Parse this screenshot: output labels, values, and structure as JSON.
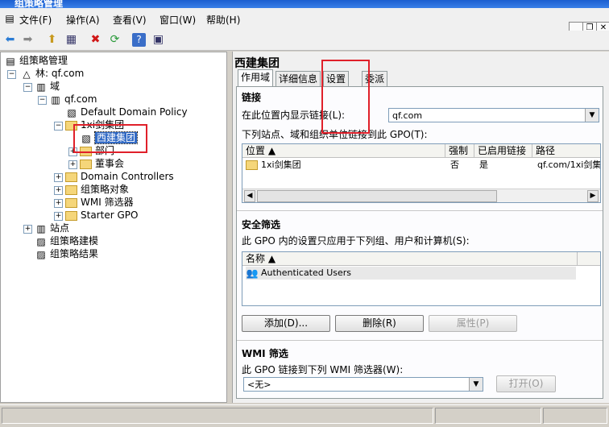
{
  "window": {
    "title": "组策略管理"
  },
  "menu": [
    "文件(F)",
    "操作(A)",
    "查看(V)",
    "窗口(W)",
    "帮助(H)"
  ],
  "tree": {
    "root": "组策略管理",
    "forest": "林: qf.com",
    "domains": "域",
    "domain": "qf.com",
    "default_policy": "Default Domain Policy",
    "ou": "1xi剑集团",
    "ou_gpo": "西建集团",
    "ou_child1": "部门",
    "ou_child2": "董事会",
    "dc": "Domain Controllers",
    "gpo_objects": "组策略对象",
    "wmi": "WMI 筛选器",
    "starter": "Starter GPO",
    "sites": "站点",
    "modeling": "组策略建模",
    "results": "组策略结果"
  },
  "detail": {
    "title": "西建集团",
    "tabs": [
      "作用域",
      "详细信息",
      "设置",
      "委派"
    ],
    "links_section": "链接",
    "links_label": "在此位置内显示链接(L):",
    "links_value": "qf.com",
    "links_desc": "下列站点、域和组织单位链接到此 GPO(T):",
    "links_columns": [
      "位置",
      "强制",
      "已启用链接",
      "路径"
    ],
    "links_rows": [
      {
        "location": "1xi剑集团",
        "enforced": "否",
        "enabled": "是",
        "path": "qf.com/1xi剑集"
      }
    ],
    "security_section": "安全筛选",
    "security_desc": "此 GPO 内的设置只应用于下列组、用户和计算机(S):",
    "security_column": "名称",
    "security_rows": [
      "Authenticated Users"
    ],
    "btn_add": "添加(D)...",
    "btn_remove": "删除(R)",
    "btn_props": "属性(P)",
    "wmi_section": "WMI 筛选",
    "wmi_desc": "此 GPO 链接到下列 WMI 筛选器(W):",
    "wmi_value": "<无>",
    "btn_open": "打开(O)"
  }
}
